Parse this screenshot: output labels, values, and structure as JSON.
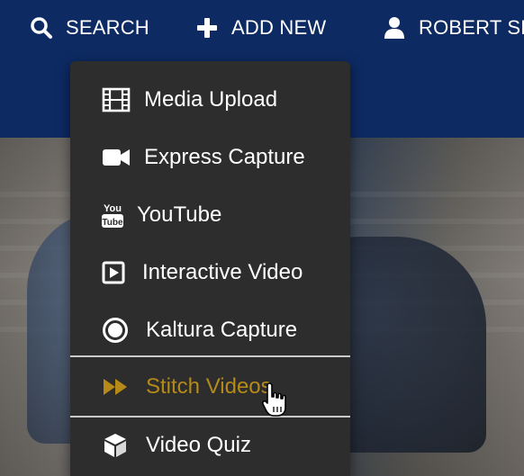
{
  "nav": {
    "search_label": "SEARCH",
    "add_new_label": "ADD NEW",
    "user_label": "ROBERT SH"
  },
  "menu": {
    "items": [
      {
        "label": "Media Upload",
        "icon": "film-icon"
      },
      {
        "label": "Express Capture",
        "icon": "video-camera-icon"
      },
      {
        "label": "YouTube",
        "icon": "youtube-icon"
      },
      {
        "label": "Interactive Video",
        "icon": "play-square-icon"
      },
      {
        "label": "Kaltura Capture",
        "icon": "record-circle-icon"
      },
      {
        "label": "Stitch Videos",
        "icon": "fast-forward-icon",
        "highlighted": true
      },
      {
        "label": "Video Quiz",
        "icon": "cube-icon"
      }
    ]
  },
  "colors": {
    "header_bg": "#0d2a63",
    "menu_bg": "#2d2d2e",
    "highlight": "#b58a19"
  }
}
